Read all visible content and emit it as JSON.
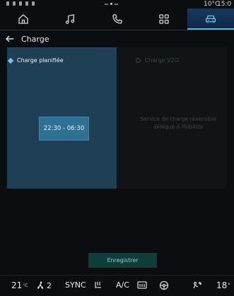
{
  "status_bar": {
    "temperature": "10°C",
    "clock": "15:0"
  },
  "nav": {
    "tabs": [
      {
        "icon": "home-icon",
        "active": false
      },
      {
        "icon": "music-icon",
        "active": false
      },
      {
        "icon": "phone-icon",
        "active": false
      },
      {
        "icon": "apps-icon",
        "active": false
      },
      {
        "icon": "car-icon",
        "active": true
      }
    ]
  },
  "header": {
    "title": "Charge"
  },
  "tabs": {
    "scheduled_label": "Charge planifiée",
    "v2g_label": "Charge V2G"
  },
  "scheduled": {
    "time_range": "22:30 - 06:30"
  },
  "v2g": {
    "service_text_line1": "Service de charge réversible",
    "service_text_line2": "délégué à Mobilize"
  },
  "footer": {
    "save_label": "Enregistrer"
  },
  "climate_bar": {
    "left_temp": "21",
    "left_unit": "°C",
    "fan_level": "2",
    "sync_label": "SYNC",
    "ac_label": "A/C",
    "right_temp": "18",
    "right_unit": "°"
  },
  "colors": {
    "accent": "#4fb3f0",
    "panel_selected": "#1f3f56",
    "time_button": "#2e6f95",
    "save_button": "#103c39"
  }
}
